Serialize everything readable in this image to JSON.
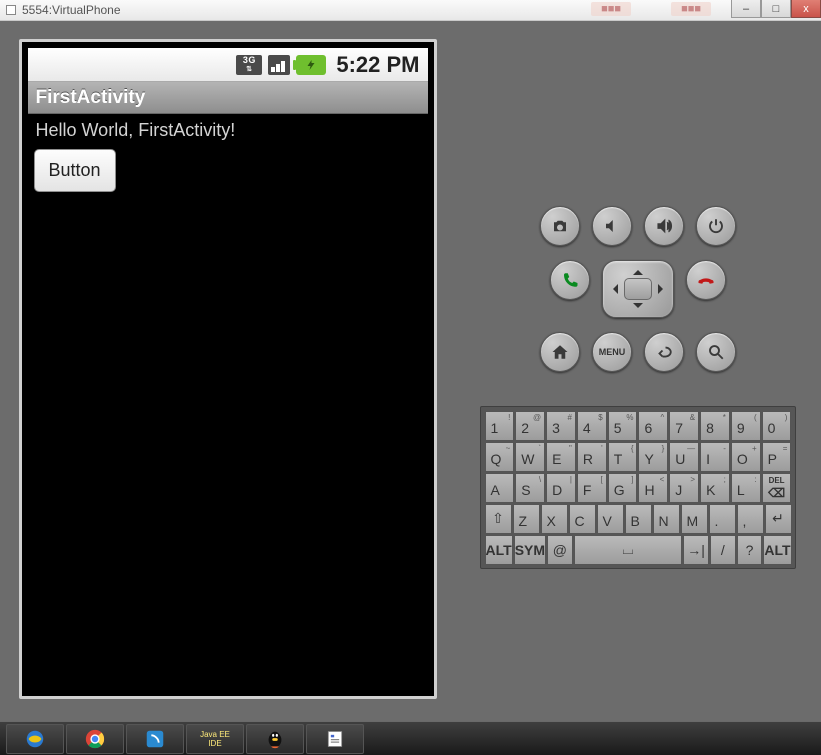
{
  "emulator": {
    "window_title": "5554:VirtualPhone",
    "win_controls": {
      "min": "–",
      "max": "□",
      "close": "x"
    }
  },
  "phone": {
    "status": {
      "network_label": "3G",
      "time": "5:22 PM"
    },
    "app": {
      "title": "FirstActivity",
      "hello_text": "Hello World, FirstActivity!",
      "button_label": "Button"
    }
  },
  "controls": {
    "menu_label": "MENU"
  },
  "keyboard": {
    "row1": [
      {
        "m": "1",
        "s": "!"
      },
      {
        "m": "2",
        "s": "@"
      },
      {
        "m": "3",
        "s": "#"
      },
      {
        "m": "4",
        "s": "$"
      },
      {
        "m": "5",
        "s": "%"
      },
      {
        "m": "6",
        "s": "^"
      },
      {
        "m": "7",
        "s": "&"
      },
      {
        "m": "8",
        "s": "*"
      },
      {
        "m": "9",
        "s": "("
      },
      {
        "m": "0",
        "s": ")"
      }
    ],
    "row2": [
      {
        "m": "Q",
        "s": "~"
      },
      {
        "m": "W",
        "s": "`"
      },
      {
        "m": "E",
        "s": "\""
      },
      {
        "m": "R",
        "s": "'"
      },
      {
        "m": "T",
        "s": "{"
      },
      {
        "m": "Y",
        "s": "}"
      },
      {
        "m": "U",
        "s": "—"
      },
      {
        "m": "I",
        "s": "-"
      },
      {
        "m": "O",
        "s": "+"
      },
      {
        "m": "P",
        "s": "="
      }
    ],
    "row3": [
      {
        "m": "A",
        "s": ""
      },
      {
        "m": "S",
        "s": "\\"
      },
      {
        "m": "D",
        "s": "|"
      },
      {
        "m": "F",
        "s": "["
      },
      {
        "m": "G",
        "s": "]"
      },
      {
        "m": "H",
        "s": "<"
      },
      {
        "m": "J",
        "s": ">"
      },
      {
        "m": "K",
        "s": ";"
      },
      {
        "m": "L",
        "s": ":"
      }
    ],
    "del_label": "DEL",
    "row4": [
      {
        "m": "Z"
      },
      {
        "m": "X"
      },
      {
        "m": "C"
      },
      {
        "m": "V"
      },
      {
        "m": "B"
      },
      {
        "m": "N"
      },
      {
        "m": "M"
      },
      {
        "m": "."
      },
      {
        "m": ","
      }
    ],
    "row5": {
      "alt": "ALT",
      "sym": "SYM",
      "at": "@",
      "slash": "/",
      "question": "?",
      "alt2": "ALT"
    }
  }
}
